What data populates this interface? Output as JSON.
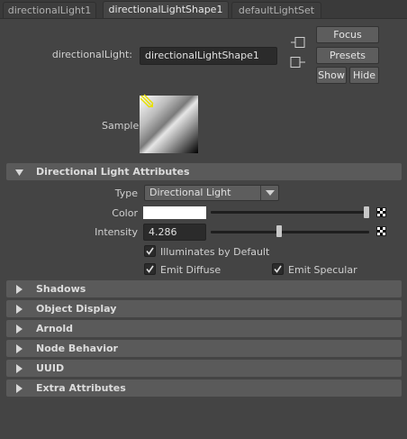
{
  "tabs": [
    {
      "label": "directionalLight1",
      "active": false
    },
    {
      "label": "directionalLightShape1",
      "active": true
    },
    {
      "label": "defaultLightSet",
      "active": false
    }
  ],
  "node": {
    "type_label": "directionalLight:",
    "name_value": "directionalLightShape1"
  },
  "buttons": {
    "focus": "Focus",
    "presets": "Presets",
    "show": "Show",
    "hide": "Hide"
  },
  "sample": {
    "label": "Sample"
  },
  "sections": {
    "directional": "Directional Light Attributes",
    "collapsed": [
      "Shadows",
      "Object Display",
      "Arnold",
      "Node Behavior",
      "UUID",
      "Extra Attributes"
    ]
  },
  "attributes": {
    "type_label": "Type",
    "type_value": "Directional Light",
    "color_label": "Color",
    "color_value": "#ffffff",
    "color_slider_fraction": 1.0,
    "intensity_label": "Intensity",
    "intensity_value": "4.286",
    "intensity_slider_fraction": 0.43,
    "illuminates_by_default": {
      "label": "Illuminates by Default",
      "checked": true
    },
    "emit_diffuse": {
      "label": "Emit Diffuse",
      "checked": true
    },
    "emit_specular": {
      "label": "Emit Specular",
      "checked": true
    }
  },
  "icons": {
    "tab_nav_in": "input-connection-icon",
    "tab_nav_out": "output-connection-icon",
    "light_icon": "directional-light-icon",
    "map_button": "checker-map-icon"
  },
  "colors": {
    "background": "#444444",
    "section_header": "#5a5a5a",
    "field_bg": "#2b2b2b",
    "button_bg": "#5d5d5d"
  }
}
